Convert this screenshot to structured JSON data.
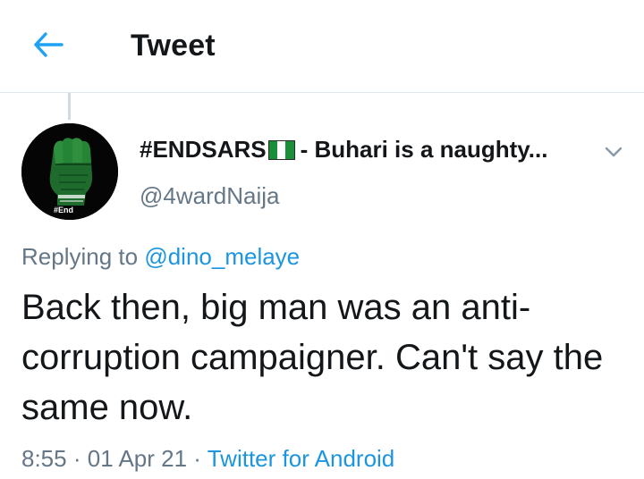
{
  "header": {
    "title": "Tweet",
    "back_icon": "arrow-left-icon",
    "accent_color": "#1DA1F2"
  },
  "tweet": {
    "author_name_prefix": "#ENDSARS",
    "author_name_suffix": " - Buhari is a naughty...",
    "flag_icon": "nigeria-flag-icon",
    "handle": "@4wardNaija",
    "avatar_text": "#End",
    "menu_icon": "chevron-down-icon",
    "replying_to_label": "Replying to",
    "replying_to_handle": "@dino_melaye",
    "text": "Back then, big man was an anti-corruption campaigner. Can't say the same now.",
    "time": "8:55",
    "date": "01 Apr 21",
    "source": "Twitter for Android",
    "separator": "·"
  },
  "colors": {
    "link": "#1B95E0",
    "secondary_text": "#657786",
    "primary_text": "#14171A",
    "divider": "#E1E8ED"
  }
}
